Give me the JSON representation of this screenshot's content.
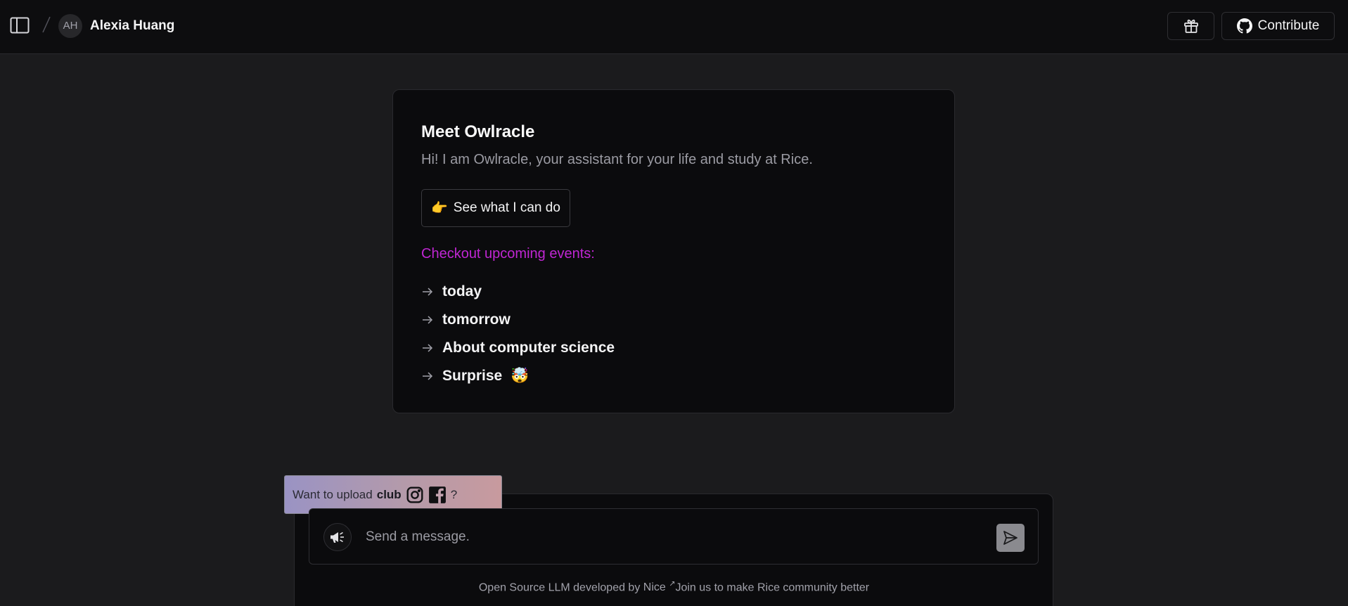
{
  "header": {
    "avatar_initials": "AH",
    "user_name": "Alexia Huang",
    "contribute_label": "Contribute"
  },
  "intro": {
    "title": "Meet Owlracle",
    "subtitle": "Hi! I am Owlracle, your assistant for your life and study at Rice.",
    "see_button_emoji": "👉",
    "see_button_label": "See what I can do",
    "events_heading": "Checkout upcoming events:",
    "events": [
      {
        "label": "today"
      },
      {
        "label": "tomorrow"
      },
      {
        "label": "About computer science"
      },
      {
        "label": "Surprise",
        "emoji": "🤯"
      }
    ]
  },
  "upload_banner": {
    "prefix": "Want to upload",
    "bold": "club",
    "suffix": "?"
  },
  "chat": {
    "placeholder": "Send a message."
  },
  "footer": {
    "prefix": "Open Source LLM developed by",
    "link": "Nice",
    "suffix": "Join us to make Rice community better"
  },
  "colors": {
    "accent_events": "#c026d3",
    "background": "#1b1b1d",
    "card": "#0b0b0d"
  },
  "icons": [
    "sidebar-toggle-icon",
    "gift-icon",
    "github-icon",
    "arrow-right-icon",
    "instagram-icon",
    "facebook-icon",
    "megaphone-icon",
    "send-icon"
  ]
}
